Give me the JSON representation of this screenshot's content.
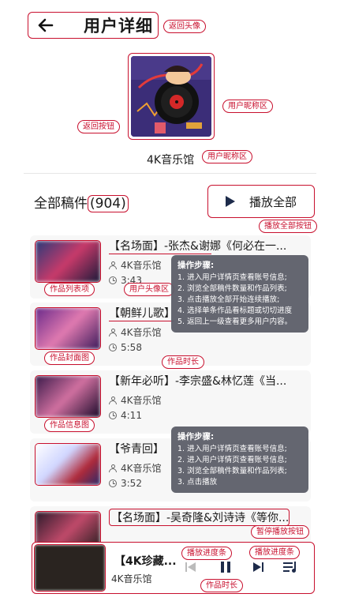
{
  "header": {
    "title": "用户详细",
    "back_tag": "返回头像"
  },
  "profile": {
    "username": "4K音乐馆",
    "avatar_tag": "用户昵称区",
    "back_button_tag": "返回按钮",
    "nickname_tag": "用户昵称区"
  },
  "works": {
    "title": "全部稿件",
    "count": "(904)",
    "play_all_label": "播放全部",
    "play_all_tag": "播放全部按钮",
    "items": [
      {
        "title": "【名场面】-张杰&谢娜《何必在一...",
        "author": "4K音乐馆",
        "duration": "3:43"
      },
      {
        "title": "【朝鲜儿歌】",
        "author": "4K音乐馆",
        "duration": "5:58"
      },
      {
        "title": "【新年必听】-李宗盛&林忆莲《当...",
        "author": "4K音乐馆",
        "duration": "4:11"
      },
      {
        "title": "【爷青回】",
        "author": "4K音乐馆",
        "duration": "3:52"
      },
      {
        "title": "【名场面】-吴奇隆&刘诗诗《等你...",
        "author": "",
        "duration": ""
      }
    ],
    "tags": {
      "list": "作品列表项",
      "avatar": "用户头像区",
      "cover": "作品封面图",
      "duration": "作品时长",
      "info_image": "作品信息图",
      "pause_button": "暂停播放按钮"
    }
  },
  "tooltips": [
    {
      "title": "操作步骤:",
      "steps": [
        "1. 进入用户详情页查看账号信息;",
        "2. 浏览全部稿件数量和作品列表;",
        "3. 点击播放全部开始连续播放;",
        "4. 选择单条作品看标题或切切进度",
        "5. 返回上一级查看更多用户内容。"
      ]
    },
    {
      "title": "操作步骤:",
      "steps": [
        "1. 进入用户详情页查看账号信息;",
        "2. 进入用户详情页查看账号信息;",
        "3. 浏览全部稿件数量和作品列表;",
        "3. 点击播放"
      ]
    }
  ],
  "player": {
    "title": "【4K珍藏...",
    "author": "4K音乐馆",
    "progress_tag_1": "播放进度条",
    "progress_tag_2": "播放进度条",
    "duration_tag": "作品时长"
  },
  "colors": {
    "annotation": "#c8102e",
    "dark_icon": "#1d2b4a",
    "tooltip_bg": "#5c5e68"
  }
}
